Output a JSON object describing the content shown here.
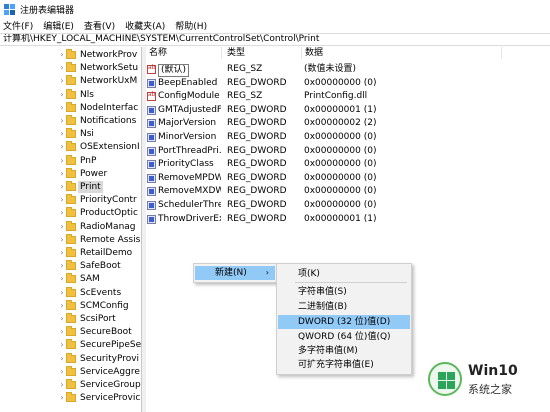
{
  "window": {
    "title": "注册表编辑器"
  },
  "menu": [
    "文件(F)",
    "编辑(E)",
    "查看(V)",
    "收藏夹(A)",
    "帮助(H)"
  ],
  "address": "计算机\\HKEY_LOCAL_MACHINE\\SYSTEM\\CurrentControlSet\\Control\\Print",
  "tree": [
    {
      "label": "NetworkProv",
      "selected": false
    },
    {
      "label": "NetworkSetu",
      "selected": false
    },
    {
      "label": "NetworkUxM",
      "selected": false
    },
    {
      "label": "Nls",
      "selected": false
    },
    {
      "label": "NodeInterfac",
      "selected": false
    },
    {
      "label": "Notifications",
      "selected": false
    },
    {
      "label": "Nsi",
      "selected": false
    },
    {
      "label": "OSExtensionI",
      "selected": false
    },
    {
      "label": "PnP",
      "selected": false
    },
    {
      "label": "Power",
      "selected": false
    },
    {
      "label": "Print",
      "selected": true
    },
    {
      "label": "PriorityContr",
      "selected": false
    },
    {
      "label": "ProductOptic",
      "selected": false
    },
    {
      "label": "RadioManag",
      "selected": false
    },
    {
      "label": "Remote Assis",
      "selected": false
    },
    {
      "label": "RetailDemo",
      "selected": false
    },
    {
      "label": "SafeBoot",
      "selected": false
    },
    {
      "label": "SAM",
      "selected": false
    },
    {
      "label": "ScEvents",
      "selected": false
    },
    {
      "label": "SCMConfig",
      "selected": false
    },
    {
      "label": "ScsiPort",
      "selected": false
    },
    {
      "label": "SecureBoot",
      "selected": false
    },
    {
      "label": "SecurePipeSe",
      "selected": false
    },
    {
      "label": "SecurityProvi",
      "selected": false
    },
    {
      "label": "ServiceAggre",
      "selected": false
    },
    {
      "label": "ServiceGroup",
      "selected": false
    },
    {
      "label": "ServiceProvic",
      "selected": false
    }
  ],
  "columns": {
    "name": "名称",
    "type": "类型",
    "data": "数据"
  },
  "values": [
    {
      "name": "(默认)",
      "type": "REG_SZ",
      "data": "(数值未设置)",
      "icon": "ab"
    },
    {
      "name": "BeepEnabled",
      "type": "REG_DWORD",
      "data": "0x00000000 (0)",
      "icon": "bin"
    },
    {
      "name": "ConfigModule",
      "type": "REG_SZ",
      "data": "PrintConfig.dll",
      "icon": "ab"
    },
    {
      "name": "GMTAdjustedF...",
      "type": "REG_DWORD",
      "data": "0x00000001 (1)",
      "icon": "bin"
    },
    {
      "name": "MajorVersion",
      "type": "REG_DWORD",
      "data": "0x00000002 (2)",
      "icon": "bin"
    },
    {
      "name": "MinorVersion",
      "type": "REG_DWORD",
      "data": "0x00000000 (0)",
      "icon": "bin"
    },
    {
      "name": "PortThreadPri...",
      "type": "REG_DWORD",
      "data": "0x00000000 (0)",
      "icon": "bin"
    },
    {
      "name": "PriorityClass",
      "type": "REG_DWORD",
      "data": "0x00000000 (0)",
      "icon": "bin"
    },
    {
      "name": "RemoveMPDW",
      "type": "REG_DWORD",
      "data": "0x00000000 (0)",
      "icon": "bin"
    },
    {
      "name": "RemoveMXDW",
      "type": "REG_DWORD",
      "data": "0x00000000 (0)",
      "icon": "bin"
    },
    {
      "name": "SchedulerThre...",
      "type": "REG_DWORD",
      "data": "0x00000000 (0)",
      "icon": "bin"
    },
    {
      "name": "ThrowDriverEx...",
      "type": "REG_DWORD",
      "data": "0x00000001 (1)",
      "icon": "bin"
    }
  ],
  "context_menu": {
    "new_label": "新建(N)",
    "arrow": "›"
  },
  "submenu": [
    {
      "label": "项(K)",
      "highlight": false
    },
    {
      "label": "字符串值(S)",
      "highlight": false
    },
    {
      "label": "二进制值(B)",
      "highlight": false
    },
    {
      "label": "DWORD (32 位)值(D)",
      "highlight": true
    },
    {
      "label": "QWORD (64 位)值(Q)",
      "highlight": false
    },
    {
      "label": "多字符串值(M)",
      "highlight": false
    },
    {
      "label": "可扩充字符串值(E)",
      "highlight": false
    }
  ],
  "watermark": {
    "line1": "Win10",
    "line2": "系统之家"
  }
}
